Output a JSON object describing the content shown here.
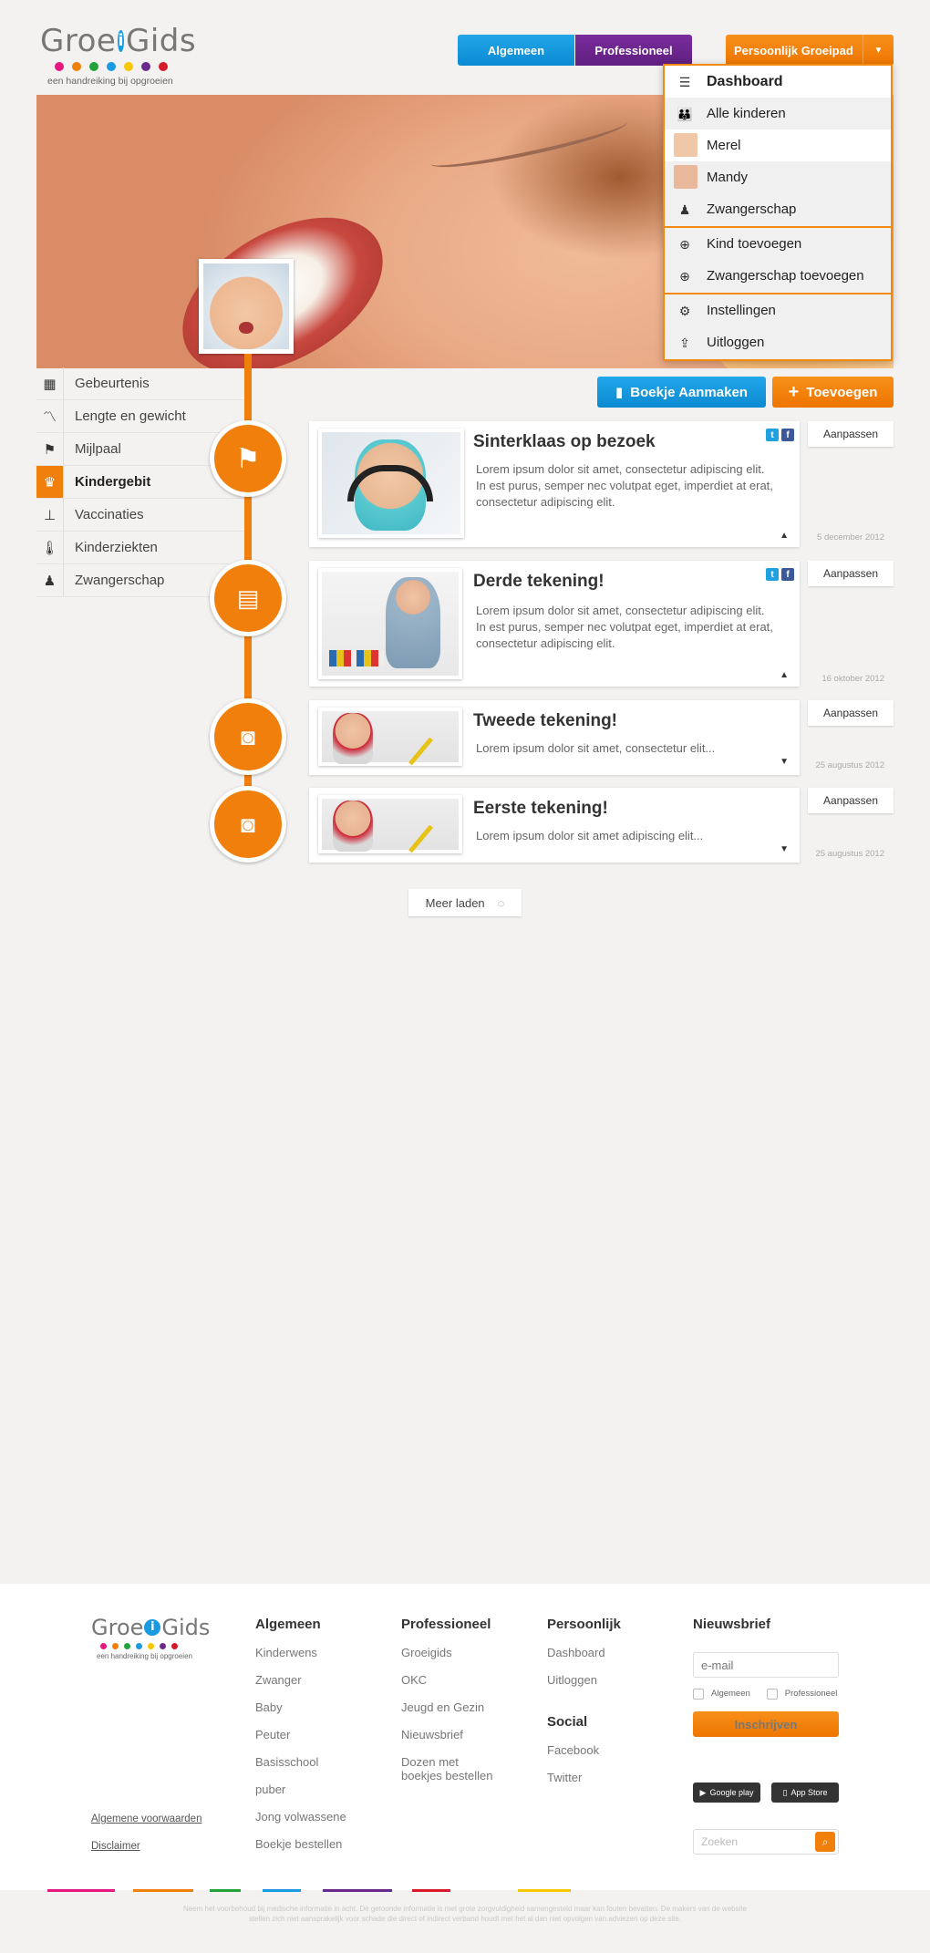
{
  "header": {
    "logo_text_pre": "Groe",
    "logo_text_i": "i",
    "logo_text_post": "Gids",
    "tagline": "een handreiking bij opgroeien",
    "logo_dot_colors": [
      "#e6177e",
      "#f07f0c",
      "#21a33a",
      "#1a9ae0",
      "#f7c800",
      "#6a2a8c",
      "#d61a2a"
    ],
    "nav_algemeen": "Algemeen",
    "nav_professioneel": "Professioneel",
    "nav_persoonlijk": "Persoonlijk Groeipad",
    "caret": "▼"
  },
  "dropdown": {
    "items": [
      {
        "label": "Dashboard",
        "icon": "list-icon"
      },
      {
        "label": "Alle kinderen",
        "icon": "group-icon"
      },
      {
        "label": "Merel",
        "icon": "child-avatar-icon"
      },
      {
        "label": "Mandy",
        "icon": "child-avatar-icon"
      },
      {
        "label": "Zwangerschap",
        "icon": "pregnant-icon"
      },
      {
        "label": "Kind toevoegen",
        "icon": "add-child-icon"
      },
      {
        "label": "Zwangerschap toevoegen",
        "icon": "add-pregnancy-icon"
      },
      {
        "label": "Instellingen",
        "icon": "gear-icon"
      },
      {
        "label": "Uitloggen",
        "icon": "logout-icon"
      }
    ]
  },
  "sidenav": {
    "items": [
      {
        "label": "Gebeurtenis",
        "icon": "calendar-icon"
      },
      {
        "label": "Lengte en gewicht",
        "icon": "chart-icon"
      },
      {
        "label": "Mijlpaal",
        "icon": "flag-icon"
      },
      {
        "label": "Kindergebit",
        "icon": "tooth-icon"
      },
      {
        "label": "Vaccinaties",
        "icon": "syringe-icon"
      },
      {
        "label": "Kinderziekten",
        "icon": "thermometer-icon"
      },
      {
        "label": "Zwangerschap",
        "icon": "pregnant-icon"
      }
    ]
  },
  "actions": {
    "book": "Boekje Aanmaken",
    "add": "Toevoegen"
  },
  "timeline": {
    "cards": [
      {
        "title": "Sinterklaas op bezoek",
        "text": "Lorem ipsum dolor sit amet, consectetur adipiscing elit. In est purus, semper nec volutpat eget, imperdiet at erat, consectetur adipiscing elit.",
        "date": "5 december 2012",
        "edit": "Aanpassen",
        "icon": "flag-icon"
      },
      {
        "title": "Derde tekening!",
        "text": "Lorem ipsum dolor sit amet, consectetur adipiscing elit. In est purus, semper nec volutpat eget, imperdiet at erat, consectetur adipiscing elit.",
        "date": "16 oktober 2012",
        "edit": "Aanpassen",
        "icon": "notepad-icon"
      },
      {
        "title": "Tweede tekening!",
        "text": "Lorem ipsum dolor sit amet, consectetur elit...",
        "date": "25 augustus 2012",
        "edit": "Aanpassen",
        "icon": "camera-icon"
      },
      {
        "title": "Eerste tekening!",
        "text": "Lorem ipsum dolor sit amet adipiscing elit...",
        "date": "25 augustus 2012",
        "edit": "Aanpassen",
        "icon": "camera-icon"
      }
    ],
    "load_more": "Meer laden"
  },
  "footer": {
    "col_algemeen": {
      "title": "Algemeen",
      "links": [
        "Kinderwens",
        "Zwanger",
        "Baby",
        "Peuter",
        "Basisschool",
        "puber",
        "Jong volwassene",
        "Boekje bestellen"
      ]
    },
    "col_professioneel": {
      "title": "Professioneel",
      "links": [
        "Groeigids",
        "OKC",
        "Jeugd en Gezin",
        "Nieuwsbrief",
        "Dozen met boekjes bestellen"
      ]
    },
    "col_persoonlijk": {
      "title": "Persoonlijk",
      "links": [
        "Dashboard",
        "Uitloggen"
      ]
    },
    "col_social": {
      "title": "Social",
      "links": [
        "Facebook",
        "Twitter"
      ]
    },
    "newsletter": {
      "title": "Nieuwsbrief",
      "email_placeholder": "e-mail",
      "opt1": "Algemeen",
      "opt2": "Professioneel",
      "submit": "Inschrijven"
    },
    "google_play": "Google play",
    "app_store": "App Store",
    "search_placeholder": "Zoeken",
    "legal1": "Algemene voorwaarden",
    "legal2": "Disclaimer",
    "disclaimer": "Neem het voorbehoud bij medische informatie in acht. De getoonde informatie is met grote zorgvuldigheid samengesteld maar kan fouten bevatten. De makers van de website stellen zich niet aansprakelijk voor schade die direct of indirect verband houdt met het al dan niet opvolgen van adviezen op deze site.",
    "bar_colors": [
      "#e6177e",
      "#f07f0c",
      "#21a33a",
      "#1a9ae0",
      "#6a2a8c",
      "#d61a2a",
      "#f7c800"
    ]
  }
}
